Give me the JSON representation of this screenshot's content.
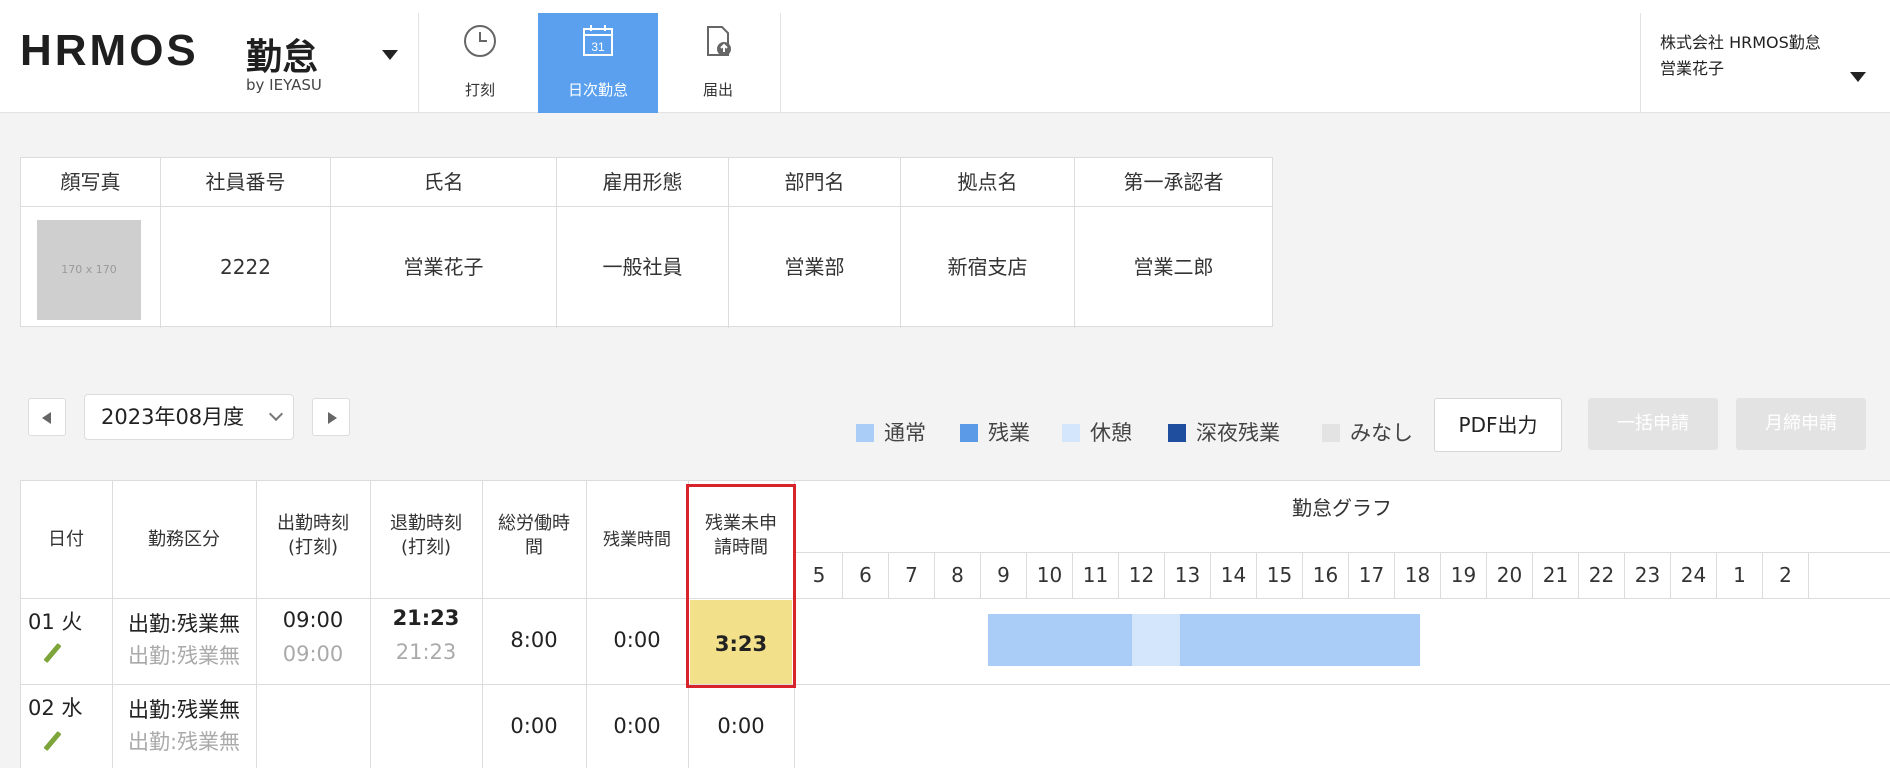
{
  "header": {
    "brand": "HRMOS",
    "product": "勤怠",
    "by": "by IEYASU",
    "tabs": [
      {
        "label": "打刻",
        "icon": "clock-icon",
        "active": false
      },
      {
        "label": "日次勤怠",
        "icon": "calendar-icon",
        "active": true
      },
      {
        "label": "届出",
        "icon": "document-icon",
        "active": false
      }
    ],
    "calendar_day": "31",
    "company": "株式会社 HRMOS勤怠",
    "user": "営業花子"
  },
  "employee": {
    "headers": [
      "顔写真",
      "社員番号",
      "氏名",
      "雇用形態",
      "部門名",
      "拠点名",
      "第一承認者"
    ],
    "photo_placeholder": "170 x 170",
    "values": [
      "2222",
      "営業花子",
      "一般社員",
      "営業部",
      "新宿支店",
      "営業二郎"
    ]
  },
  "controls": {
    "month": "2023年08月度",
    "legend": [
      {
        "label": "通常",
        "color": "#a9cdf6"
      },
      {
        "label": "残業",
        "color": "#5b9ae6"
      },
      {
        "label": "休憩",
        "color": "#d4e6fb"
      },
      {
        "label": "深夜残業",
        "color": "#1f4e9e"
      },
      {
        "label": "みなし",
        "color": "#e3e3e3"
      }
    ],
    "pdf": "PDF出力",
    "bulk_apply": "一括申請",
    "monthly_apply": "月締申請"
  },
  "table": {
    "headers": {
      "date": "日付",
      "work_type": "勤務区分",
      "clock_in": [
        "出勤時刻",
        "(打刻)"
      ],
      "clock_out": [
        "退勤時刻",
        "(打刻)"
      ],
      "total": [
        "総労働時",
        "間"
      ],
      "overtime": "残業時間",
      "unapplied": [
        "残業未申",
        "請時間"
      ],
      "graph": "勤怠グラフ"
    },
    "hours": [
      "5",
      "6",
      "7",
      "8",
      "9",
      "10",
      "11",
      "12",
      "13",
      "14",
      "15",
      "16",
      "17",
      "18",
      "19",
      "20",
      "21",
      "22",
      "23",
      "24",
      "1",
      "2"
    ],
    "rows": [
      {
        "date": "01 火",
        "type": "出勤:残業無",
        "type_sub": "出勤:残業無",
        "in": "09:00",
        "in_sub": "09:00",
        "out": "21:23",
        "out_sub": "21:23",
        "total": "8:00",
        "overtime": "0:00",
        "unapplied": "3:23"
      },
      {
        "date": "02 水",
        "type": "出勤:残業無",
        "type_sub": "出勤:残業無",
        "in": "",
        "in_sub": "",
        "out": "",
        "out_sub": "",
        "total": "0:00",
        "overtime": "0:00",
        "unapplied": "0:00"
      }
    ]
  }
}
